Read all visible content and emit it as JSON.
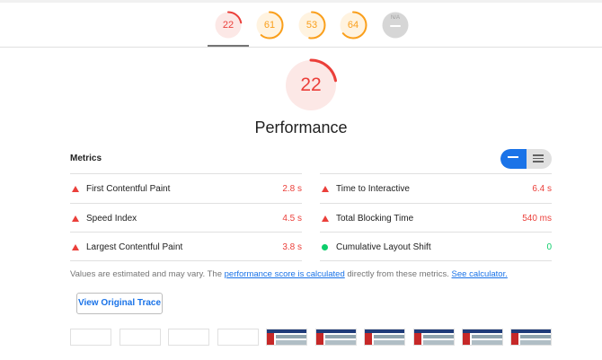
{
  "score_tabs": [
    {
      "label": "22",
      "score": 22,
      "color": "#eb3f3a",
      "bg": "#fce8e6",
      "active": true
    },
    {
      "label": "61",
      "score": 61,
      "color": "#fa9f1b",
      "bg": "#fff3e0",
      "active": false
    },
    {
      "label": "53",
      "score": 53,
      "color": "#fa9f1b",
      "bg": "#fff3e0",
      "active": false
    },
    {
      "label": "64",
      "score": 64,
      "color": "#fa9f1b",
      "bg": "#fff3e0",
      "active": false
    },
    {
      "label": "N/A",
      "score": null,
      "color": "#bdbdbd",
      "bg": "#d6d6d6",
      "active": false
    }
  ],
  "category": {
    "score": 22,
    "score_label": "22",
    "title": "Performance",
    "color": "#eb3f3a",
    "bg": "#fce8e6"
  },
  "metrics": {
    "heading": "Metrics",
    "toggle": {
      "active_view": "compact",
      "icons": [
        "compact-list-icon",
        "expanded-list-icon"
      ]
    },
    "left": [
      {
        "name": "First Contentful Paint",
        "value": "2.8 s",
        "status": "fail"
      },
      {
        "name": "Speed Index",
        "value": "4.5 s",
        "status": "fail"
      },
      {
        "name": "Largest Contentful Paint",
        "value": "3.8 s",
        "status": "fail"
      }
    ],
    "right": [
      {
        "name": "Time to Interactive",
        "value": "6.4 s",
        "status": "fail"
      },
      {
        "name": "Total Blocking Time",
        "value": "540 ms",
        "status": "fail"
      },
      {
        "name": "Cumulative Layout Shift",
        "value": "0",
        "status": "pass"
      }
    ]
  },
  "note": {
    "prefix": "Values are estimated and may vary. The ",
    "link1": "performance score is calculated",
    "middle": " directly from these metrics. ",
    "link2": "See calculator."
  },
  "trace_button": "View Original Trace",
  "filmstrip": {
    "frames": [
      "blank",
      "blank",
      "blank",
      "blank",
      "screenshot",
      "screenshot",
      "screenshot",
      "screenshot",
      "screenshot",
      "screenshot"
    ]
  },
  "colors": {
    "fail": "#eb3f3a",
    "average": "#fa9f1b",
    "pass": "#0cce6b",
    "link": "#1a73e8"
  }
}
